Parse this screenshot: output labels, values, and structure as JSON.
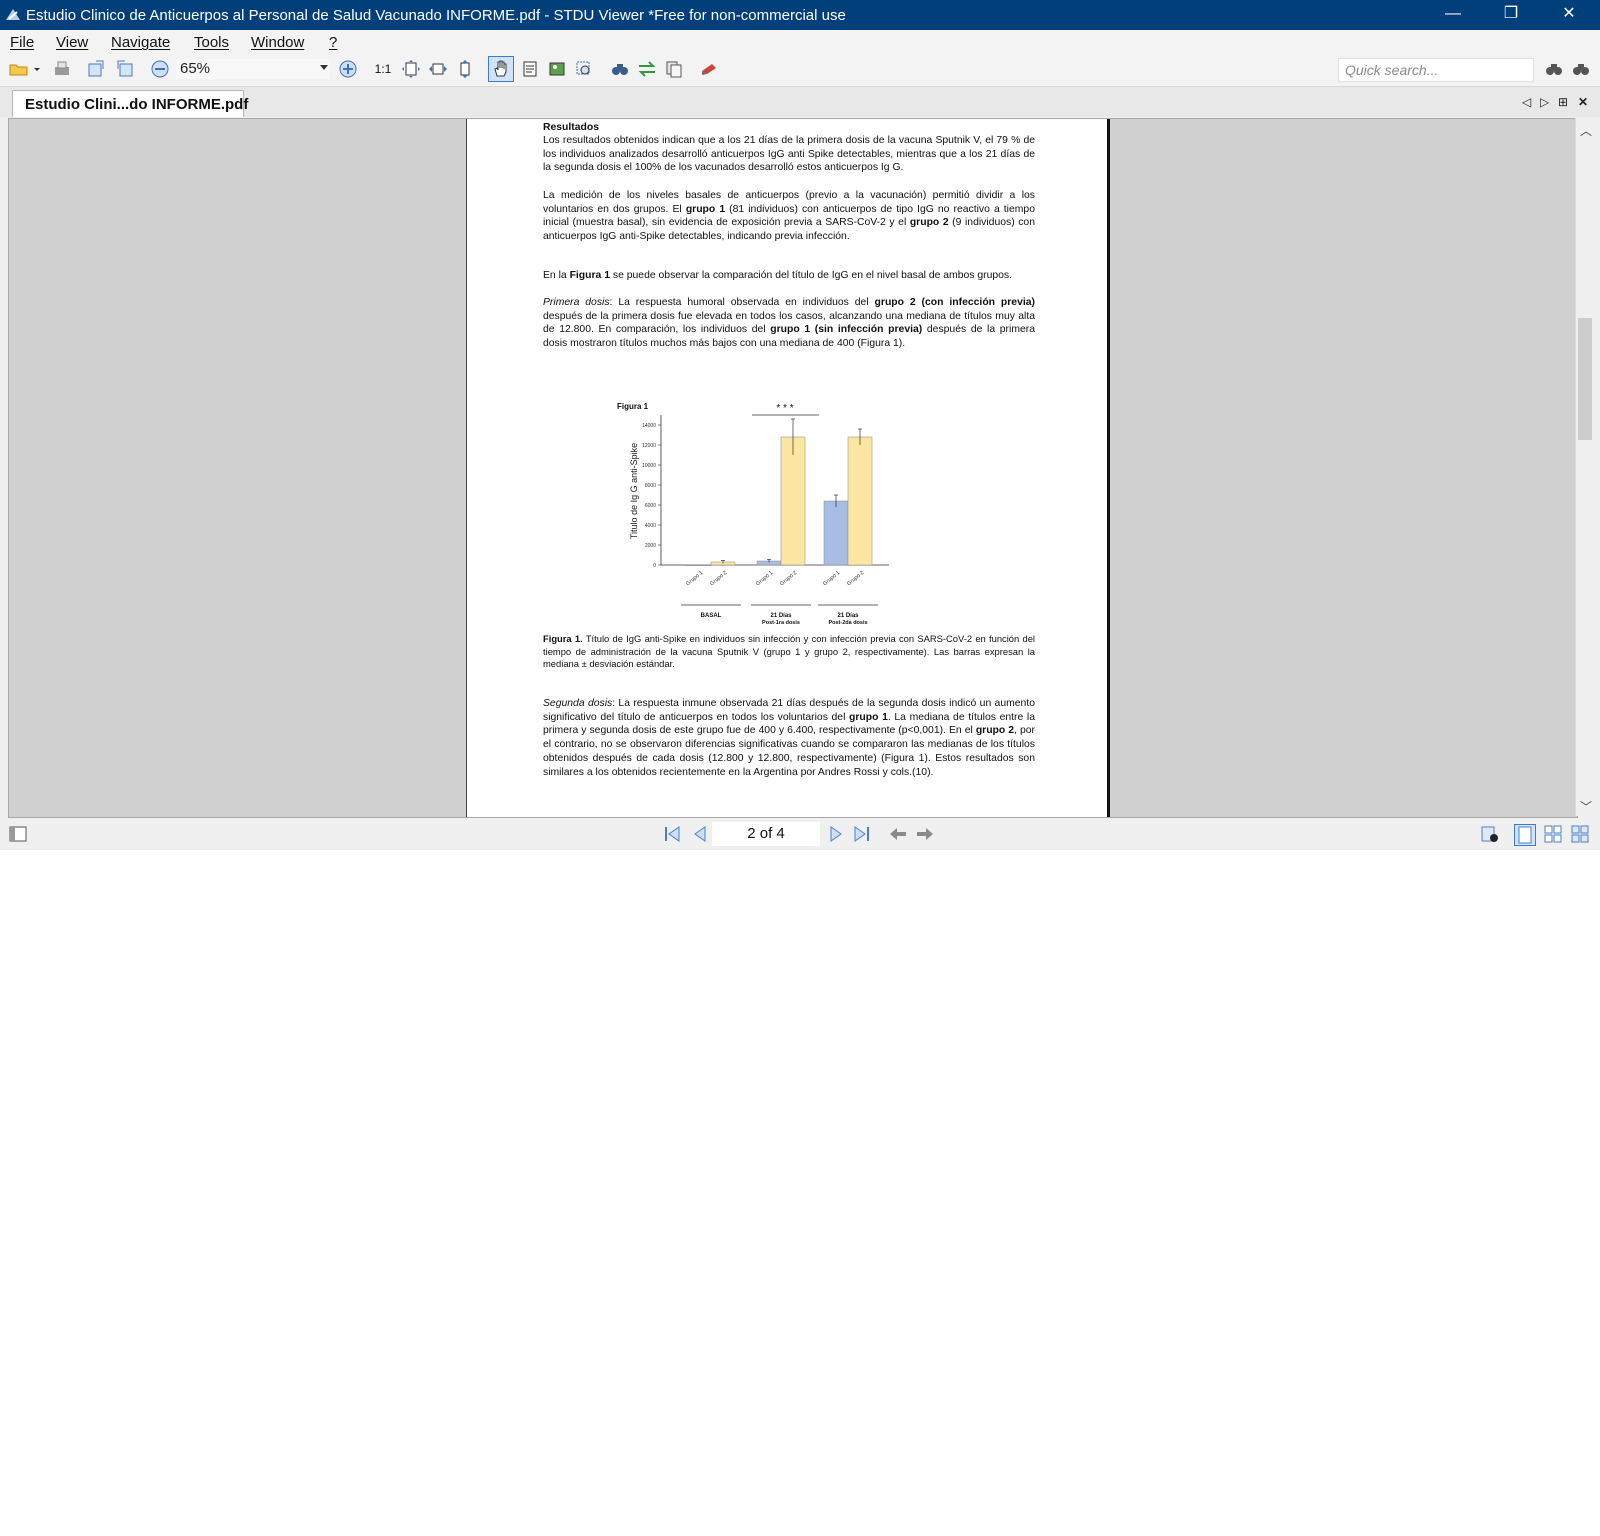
{
  "window": {
    "title": "Estudio Clinico de Anticuerpos al Personal de Salud  Vacunado INFORME.pdf - STDU Viewer *Free for non-commercial use",
    "minimize": "—",
    "restore": "❐",
    "close": "✕"
  },
  "menu": {
    "file": "File",
    "view": "View",
    "navigate": "Navigate",
    "tools": "Tools",
    "window": "Window",
    "help": "?"
  },
  "toolbar": {
    "zoom": "65%",
    "one_to_one": "1:1",
    "quick_search_placeholder": "Quick search..."
  },
  "tabs": {
    "active": "Estudio Clini...do INFORME.pdf"
  },
  "status": {
    "page_indicator": "2 of 4"
  },
  "document": {
    "heading": "Resultados",
    "para1": "Los resultados obtenidos indican que a los 21 días de la primera dosis de la vacuna Sputnik V, el 79 % de los individuos analizados desarrolló anticuerpos IgG anti Spike detectables, mientras que a los 21 días de la segunda dosis el 100% de los vacunados desarrolló estos anticuerpos Ig G.",
    "para2_a": "La medición de los niveles basales de anticuerpos (previo a la vacunación) permitió dividir a los voluntarios en dos grupos. El ",
    "para2_b": "grupo 1",
    "para2_c": " (81 individuos) con anticuerpos de tipo IgG no reactivo a tiempo inicial (muestra basal), sin evidencia de exposición previa a SARS-CoV-2 y el ",
    "para2_d": "grupo 2",
    "para2_e": " (9 individuos) con anticuerpos IgG anti-Spike detectables, indicando previa infección.",
    "para3_a": "En la ",
    "para3_b": "Figura 1",
    "para3_c": " se puede observar la comparación del título de IgG en el nivel basal de ambos grupos.",
    "para4_a": "Primera dosis",
    "para4_b": ": La respuesta humoral observada en individuos del ",
    "para4_c": "grupo 2 (con infección previa)",
    "para4_d": " después de la primera dosis fue elevada en todos los casos, alcanzando una mediana de títulos muy alta de 12.800. En comparación, los individuos del ",
    "para4_e": "grupo 1 (sin infección previa)",
    "para4_f": " después de la primera dosis mostraron títulos muchos más bajos con una mediana de 400 (Figura 1).",
    "caption_a": "Figura 1.",
    "caption_b": " Título de IgG anti-Spike en individuos sin infección y con infección previa con SARS-CoV-2 en función del tiempo de administración de la vacuna Sputnik V (grupo 1 y grupo 2, respectivamente). Las barras expresan la mediana ± desviación estándar.",
    "para5_a": "Segunda dosis",
    "para5_b": ": La respuesta inmune observada 21 días después de la segunda dosis indicó un aumento significativo del título de anticuerpos en todos los voluntarios del ",
    "para5_c": "grupo 1",
    "para5_d": ". La mediana de títulos entre la primera y segunda dosis de este grupo fue de 400 y 6.400, respectivamente (p<0,001). En el ",
    "para5_e": "grupo 2",
    "para5_f": ", por el contrario, no se observaron diferencias significativas cuando se compararon las medianas de los títulos obtenidos después de cada dosis (12.800 y 12.800, respectivamente) (Figura 1). Estos resultados son similares a los obtenidos recientemente en la Argentina por Andres Rossi y cols.(10)."
  },
  "chart_data": {
    "type": "bar",
    "title": "Figura 1",
    "ylabel": "Titulo de Ig G anti-Spike",
    "ylim": [
      0,
      15000
    ],
    "yticks": [
      0,
      2000,
      4000,
      6000,
      8000,
      10000,
      12000,
      14000
    ],
    "ytick_labels": [
      "0",
      "2000",
      "4000",
      "6000",
      "8000",
      "10000",
      "12000",
      "14000"
    ],
    "groups": [
      {
        "label": "BASAL",
        "sublabel": ""
      },
      {
        "label": "21 Días",
        "sublabel": "Post-1ra dosis"
      },
      {
        "label": "21 Días",
        "sublabel": "Post-2da dosis"
      }
    ],
    "bar_labels": [
      "Grupo 1",
      "Grupo 2"
    ],
    "series": [
      {
        "values": [
          0,
          400,
          6400
        ],
        "errors": [
          0,
          150,
          600
        ],
        "color": "#a8bde3"
      },
      {
        "values": [
          300,
          12800,
          12800
        ],
        "errors": [
          150,
          1800,
          800
        ],
        "color": "#fbe7a1"
      }
    ],
    "significance": "*   *   *"
  }
}
